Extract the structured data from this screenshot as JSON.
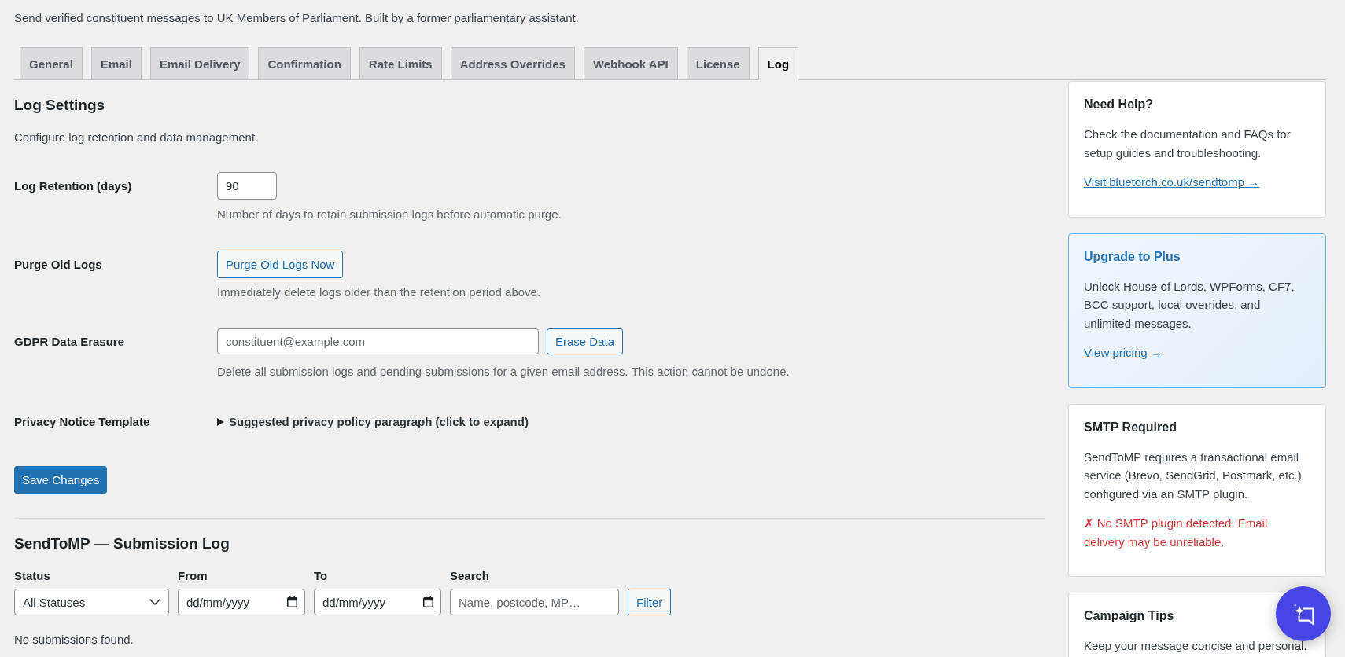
{
  "header": {
    "description": "Send verified constituent messages to UK Members of Parliament. Built by a former parliamentary assistant."
  },
  "tabs": [
    {
      "label": "General",
      "selected": false
    },
    {
      "label": "Email",
      "selected": false
    },
    {
      "label": "Email Delivery",
      "selected": false
    },
    {
      "label": "Confirmation",
      "selected": false
    },
    {
      "label": "Rate Limits",
      "selected": false
    },
    {
      "label": "Address Overrides",
      "selected": false
    },
    {
      "label": "Webhook API",
      "selected": false
    },
    {
      "label": "License",
      "selected": false
    },
    {
      "label": "Log",
      "selected": true
    }
  ],
  "log_settings": {
    "title": "Log Settings",
    "description": "Configure log retention and data management.",
    "fields": [
      {
        "kind": "number",
        "label": "Log Retention (days)",
        "value": "90",
        "description": "Number of days to retain submission logs before automatic purge."
      },
      {
        "kind": "button",
        "label": "Purge Old Logs",
        "button": "Purge Old Logs Now",
        "description": "Immediately delete logs older than the retention period above."
      },
      {
        "kind": "email",
        "label": "GDPR Data Erasure",
        "placeholder": "constituent@example.com",
        "button": "Erase Data",
        "description": "Delete all submission logs and pending submissions for a given email address. This action cannot be undone."
      },
      {
        "kind": "details",
        "label": "Privacy Notice Template",
        "summary": "Suggested privacy policy paragraph (click to expand)",
        "expanded": false
      }
    ],
    "save_button": "Save Changes"
  },
  "submission_log": {
    "title": "SendToMP — Submission Log",
    "filters": [
      {
        "kind": "select",
        "label": "Status",
        "value": "All Statuses"
      },
      {
        "kind": "date",
        "label": "From",
        "placeholder": "dd/mm/yyyy"
      },
      {
        "kind": "date",
        "label": "To",
        "placeholder": "dd/mm/yyyy"
      },
      {
        "kind": "search",
        "label": "Search",
        "placeholder": "Name, postcode, MP…"
      }
    ],
    "filter_button": "Filter",
    "empty_message": "No submissions found."
  },
  "sidebar": {
    "cards": [
      {
        "kind": "plain",
        "title": "Need Help?",
        "text": "Check the documentation and FAQs for setup guides and troubleshooting.",
        "link": "Visit bluetorch.co.uk/sendtomp →"
      },
      {
        "kind": "highlight",
        "title": "Upgrade to Plus",
        "text": "Unlock House of Lords, WPForms, CF7, BCC support, local overrides, and unlimited messages.",
        "link": "View pricing →"
      },
      {
        "kind": "plain",
        "title": "SMTP Required",
        "text": "SendToMP requires a transactional email service (Brevo, SendGrid, Postmark, etc.) configured via an SMTP plugin.",
        "alert": "✗ No SMTP plugin detected. Email delivery may be unreliable."
      },
      {
        "kind": "tips",
        "title": "Campaign Tips",
        "text": "Keep your message concise and personal."
      }
    ]
  }
}
